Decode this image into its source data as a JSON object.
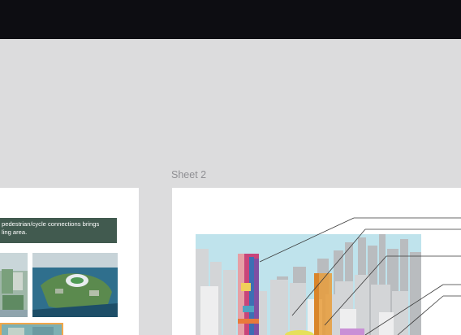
{
  "canvas": {
    "sheet2_label": "Sheet 2"
  },
  "sheet_left": {
    "callout_line1": "pedestrian/cycle connections brings",
    "callout_line2": "ling area."
  },
  "colors": {
    "topbar": "#0d0d12",
    "canvas_bg": "#dcdcdd",
    "callout_bg": "#415a4f",
    "highlight_tower": "#e79c3a",
    "colorful_tower": "#c8457a",
    "sky": "#bfe3ec"
  },
  "icons": {
    "thumb_1": "site-render-image",
    "thumb_2": "stadium-aerial-image",
    "thumb_3": "site-render-image",
    "illustration": "city-massing-model-image"
  }
}
